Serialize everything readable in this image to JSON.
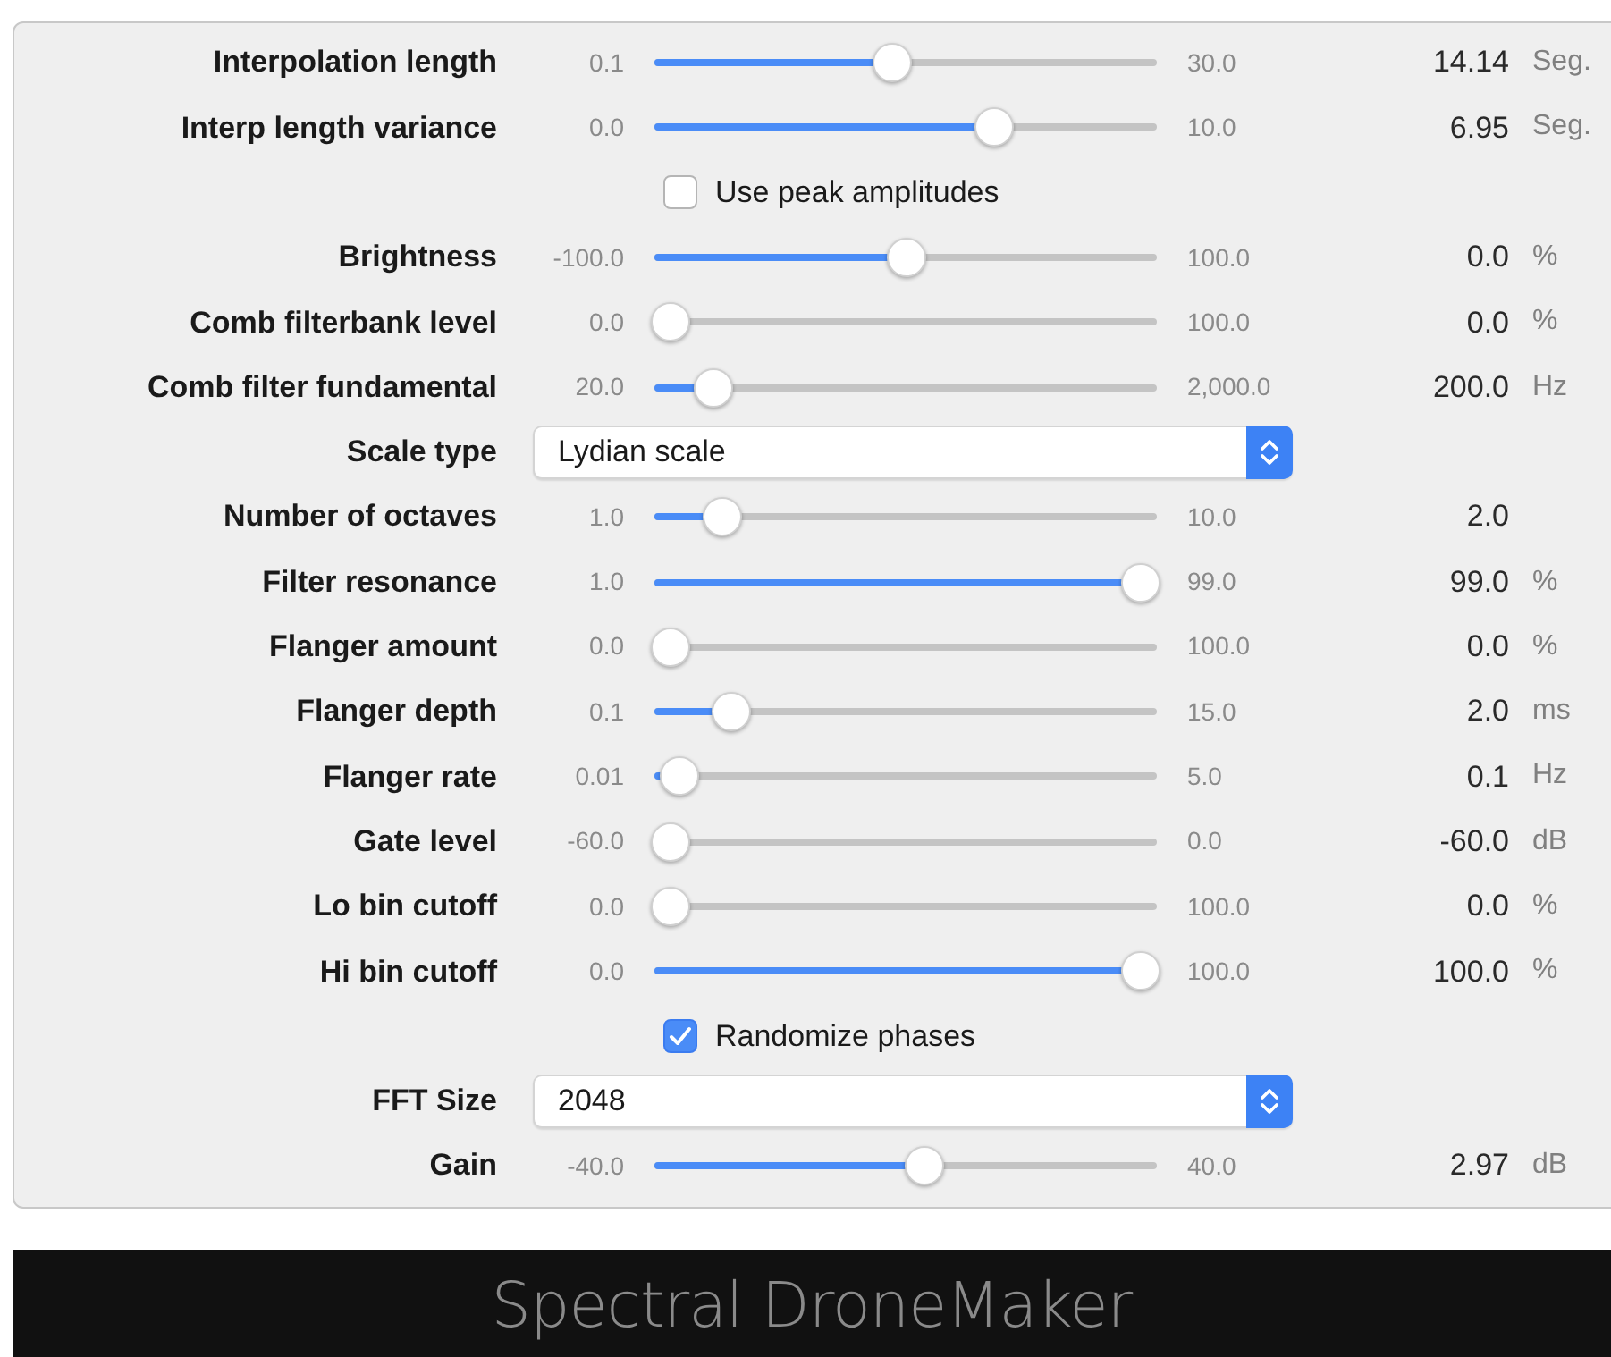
{
  "rows": [
    {
      "kind": "slider",
      "label": "Interpolation length",
      "min": "0.1",
      "max": "30.0",
      "level": 0.47,
      "value": "14.14",
      "unit": "Seg."
    },
    {
      "kind": "slider",
      "label": "Interp length variance",
      "min": "0.0",
      "max": "10.0",
      "level": 0.69,
      "value": "6.95",
      "unit": "Seg."
    },
    {
      "kind": "checkbox",
      "label": "Use peak amplitudes",
      "checked": false
    },
    {
      "kind": "slider",
      "label": "Brightness",
      "min": "-100.0",
      "max": "100.0",
      "level": 0.5,
      "value": "0.0",
      "unit": "%"
    },
    {
      "kind": "slider",
      "label": "Comb filterbank level",
      "min": "0.0",
      "max": "100.0",
      "level": 0,
      "value": "0.0",
      "unit": "%"
    },
    {
      "kind": "slider",
      "label": "Comb filter fundamental",
      "min": "20.0",
      "max": "2,000.0",
      "level": 0.09,
      "value": "200.0",
      "unit": "Hz"
    },
    {
      "kind": "select",
      "label": "Scale type",
      "value": "Lydian scale"
    },
    {
      "kind": "slider",
      "label": "Number of octaves",
      "min": "1.0",
      "max": "10.0",
      "level": 0.11,
      "value": "2.0"
    },
    {
      "kind": "slider",
      "label": "Filter resonance",
      "min": "1.0",
      "max": "99.0",
      "level": 1,
      "value": "99.0",
      "unit": "%"
    },
    {
      "kind": "slider",
      "label": "Flanger amount",
      "min": "0.0",
      "max": "100.0",
      "level": 0,
      "value": "0.0",
      "unit": "%"
    },
    {
      "kind": "slider",
      "label": "Flanger depth",
      "min": "0.1",
      "max": "15.0",
      "level": 0.13,
      "value": "2.0",
      "unit": "ms"
    },
    {
      "kind": "slider",
      "label": "Flanger rate",
      "min": "0.01",
      "max": "5.0",
      "level": 0.02,
      "value": "0.1",
      "unit": "Hz"
    },
    {
      "kind": "slider",
      "label": "Gate level",
      "min": "-60.0",
      "max": "0.0",
      "level": 0,
      "value": "-60.0",
      "unit": "dB"
    },
    {
      "kind": "slider",
      "label": "Lo bin cutoff",
      "min": "0.0",
      "max": "100.0",
      "level": 0,
      "value": "0.0",
      "unit": "%"
    },
    {
      "kind": "slider",
      "label": "Hi bin cutoff",
      "min": "0.0",
      "max": "100.0",
      "level": 1,
      "value": "100.0",
      "unit": "%"
    },
    {
      "kind": "checkbox",
      "label": "Randomize phases",
      "checked": true
    },
    {
      "kind": "select",
      "label": "FFT Size",
      "value": "2048"
    },
    {
      "kind": "slider",
      "label": "Gain",
      "min": "-40.0",
      "max": "40.0",
      "level": 0.54,
      "value": "2.97",
      "unit": "dB"
    }
  ],
  "footer": {
    "title": "Spectral DroneMaker"
  }
}
